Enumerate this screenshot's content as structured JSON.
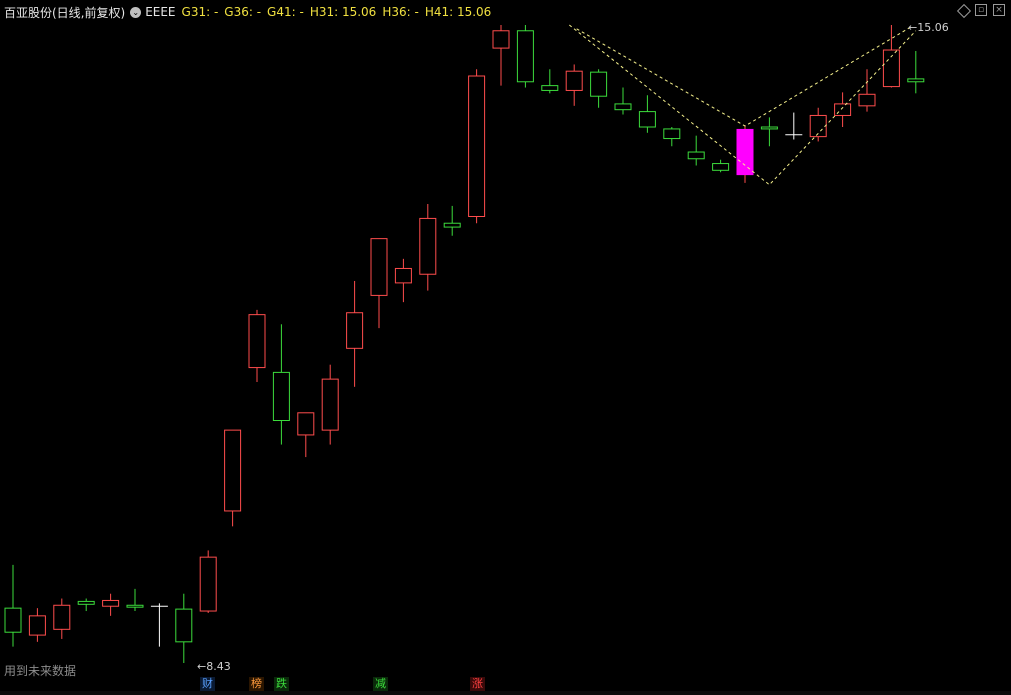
{
  "header": {
    "title": "百亚股份(日线,前复权)",
    "circle_glyph": "⌄",
    "formula_name": "EEEE",
    "items": [
      "G31: -",
      "G36: -",
      "G41: -",
      "H31: 15.06",
      "H36: -",
      "H41: 15.06"
    ]
  },
  "top_icons": [
    "diamond-icon",
    "restore-icon",
    "close-icon"
  ],
  "notice": "用到未来数据",
  "price_labels": {
    "high": "15.06",
    "low": "8.43"
  },
  "badges": [
    {
      "text": "财",
      "color": "#5aa0ff",
      "bg": "#0a1a33"
    },
    {
      "text": "榜",
      "color": "#ff9a3c",
      "bg": "#2a1500"
    },
    {
      "text": "跌",
      "color": "#3cdc3c",
      "bg": "#0a2a0a"
    },
    {
      "text": "减",
      "color": "#3cdc3c",
      "bg": "#0a2a0a"
    },
    {
      "text": "涨",
      "color": "#ff4040",
      "bg": "#3a0a0a"
    }
  ],
  "colors": {
    "up": "#ff4d4d",
    "down": "#3cdc3c",
    "doji": "#ffffff",
    "highlight": "#ff00ff",
    "pattern": "#f5f08c"
  },
  "chart_data": {
    "type": "candlestick",
    "title": "",
    "candles": [
      {
        "o": 9.0,
        "h": 9.45,
        "l": 8.6,
        "c": 8.75,
        "kind": "down"
      },
      {
        "o": 8.72,
        "h": 9.0,
        "l": 8.65,
        "c": 8.92,
        "kind": "up"
      },
      {
        "o": 8.78,
        "h": 9.1,
        "l": 8.68,
        "c": 9.03,
        "kind": "up"
      },
      {
        "o": 9.07,
        "h": 9.1,
        "l": 8.97,
        "c": 9.04,
        "kind": "down"
      },
      {
        "o": 9.02,
        "h": 9.15,
        "l": 8.92,
        "c": 9.08,
        "kind": "up"
      },
      {
        "o": 9.03,
        "h": 9.2,
        "l": 8.97,
        "c": 9.01,
        "kind": "down"
      },
      {
        "o": 9.02,
        "h": 9.05,
        "l": 8.6,
        "c": 9.02,
        "kind": "doji"
      },
      {
        "o": 8.99,
        "h": 9.15,
        "l": 8.43,
        "c": 8.65,
        "kind": "down"
      },
      {
        "o": 8.97,
        "h": 9.6,
        "l": 8.95,
        "c": 9.53,
        "kind": "up"
      },
      {
        "o": 10.01,
        "h": 10.75,
        "l": 9.85,
        "c": 10.85,
        "kind": "up"
      },
      {
        "o": 11.5,
        "h": 12.1,
        "l": 11.35,
        "c": 12.05,
        "kind": "up"
      },
      {
        "o": 11.45,
        "h": 11.95,
        "l": 10.7,
        "c": 10.95,
        "kind": "down"
      },
      {
        "o": 10.8,
        "h": 11.0,
        "l": 10.57,
        "c": 11.03,
        "kind": "up"
      },
      {
        "o": 10.85,
        "h": 11.53,
        "l": 10.7,
        "c": 11.38,
        "kind": "up"
      },
      {
        "o": 11.7,
        "h": 12.4,
        "l": 11.3,
        "c": 12.07,
        "kind": "up"
      },
      {
        "o": 12.25,
        "h": 12.41,
        "l": 11.91,
        "c": 12.84,
        "kind": "up"
      },
      {
        "o": 12.38,
        "h": 12.63,
        "l": 12.18,
        "c": 12.53,
        "kind": "up"
      },
      {
        "o": 12.47,
        "h": 13.2,
        "l": 12.3,
        "c": 13.05,
        "kind": "up"
      },
      {
        "o": 13.0,
        "h": 13.18,
        "l": 12.87,
        "c": 12.96,
        "kind": "down"
      },
      {
        "o": 13.07,
        "h": 14.6,
        "l": 13.0,
        "c": 14.53,
        "kind": "up"
      },
      {
        "o": 14.82,
        "h": 15.06,
        "l": 14.43,
        "c": 15.0,
        "kind": "up"
      },
      {
        "o": 15.0,
        "h": 15.06,
        "l": 14.41,
        "c": 14.47,
        "kind": "down"
      },
      {
        "o": 14.43,
        "h": 14.6,
        "l": 14.35,
        "c": 14.38,
        "kind": "down"
      },
      {
        "o": 14.38,
        "h": 14.65,
        "l": 14.22,
        "c": 14.58,
        "kind": "up"
      },
      {
        "o": 14.57,
        "h": 14.6,
        "l": 14.2,
        "c": 14.32,
        "kind": "down"
      },
      {
        "o": 14.24,
        "h": 14.41,
        "l": 14.13,
        "c": 14.18,
        "kind": "down"
      },
      {
        "o": 14.16,
        "h": 14.33,
        "l": 13.94,
        "c": 14.0,
        "kind": "down"
      },
      {
        "o": 13.98,
        "h": 14.0,
        "l": 13.8,
        "c": 13.88,
        "kind": "down"
      },
      {
        "o": 13.74,
        "h": 13.91,
        "l": 13.6,
        "c": 13.67,
        "kind": "down"
      },
      {
        "o": 13.62,
        "h": 13.66,
        "l": 13.53,
        "c": 13.55,
        "kind": "down"
      },
      {
        "o": 13.5,
        "h": 14.02,
        "l": 13.42,
        "c": 13.98,
        "kind": "highlight"
      },
      {
        "o": 13.98,
        "h": 14.1,
        "l": 13.8,
        "c": 14.0,
        "kind": "down"
      },
      {
        "o": 13.92,
        "h": 14.15,
        "l": 13.87,
        "c": 13.92,
        "kind": "doji"
      },
      {
        "o": 13.9,
        "h": 14.2,
        "l": 13.85,
        "c": 14.12,
        "kind": "up"
      },
      {
        "o": 14.12,
        "h": 14.36,
        "l": 14.0,
        "c": 14.24,
        "kind": "up"
      },
      {
        "o": 14.22,
        "h": 14.6,
        "l": 14.16,
        "c": 14.34,
        "kind": "up"
      },
      {
        "o": 14.42,
        "h": 15.06,
        "l": 14.41,
        "c": 14.8,
        "kind": "up"
      },
      {
        "o": 14.47,
        "h": 14.79,
        "l": 14.35,
        "c": 14.5,
        "kind": "down"
      }
    ],
    "pattern_points": [
      {
        "i": 23.1,
        "p": 15.02
      },
      {
        "i": 30.0,
        "p": 14.01
      },
      {
        "i": 31.0,
        "p": 13.4
      },
      {
        "i": 36.8,
        "p": 15.04
      },
      {
        "i": 30.0,
        "p": 14.0
      },
      {
        "i": 37.0,
        "p": 15.0
      }
    ]
  }
}
